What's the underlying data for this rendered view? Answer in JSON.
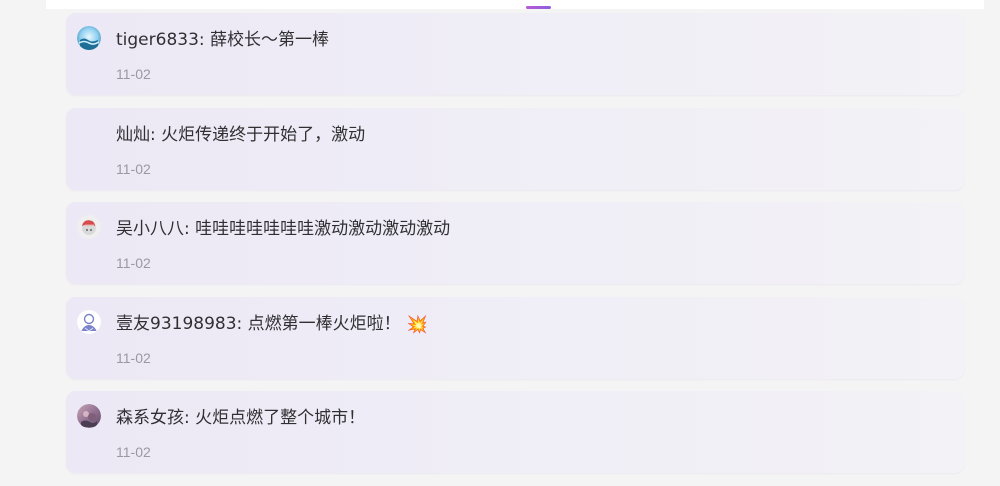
{
  "comments": [
    {
      "username": "tiger6833",
      "text": "薛校长～第一棒",
      "time": "11-02",
      "avatar": "ocean-avatar-icon",
      "emoji": ""
    },
    {
      "username": "灿灿",
      "text": "火炬传递终于开始了，激动",
      "time": "11-02",
      "avatar": "",
      "emoji": ""
    },
    {
      "username": "吴小八八",
      "text": "哇哇哇哇哇哇哇激动激动激动激动",
      "time": "11-02",
      "avatar": "red-hat-avatar-icon",
      "emoji": ""
    },
    {
      "username": "壹友93198983",
      "text": "点燃第一棒火炬啦！",
      "time": "11-02",
      "avatar": "default-user-avatar-icon",
      "emoji": "💥"
    },
    {
      "username": "森系女孩",
      "text": "火炬点燃了整个城市！",
      "time": "11-02",
      "avatar": "flower-avatar-icon",
      "emoji": ""
    }
  ]
}
